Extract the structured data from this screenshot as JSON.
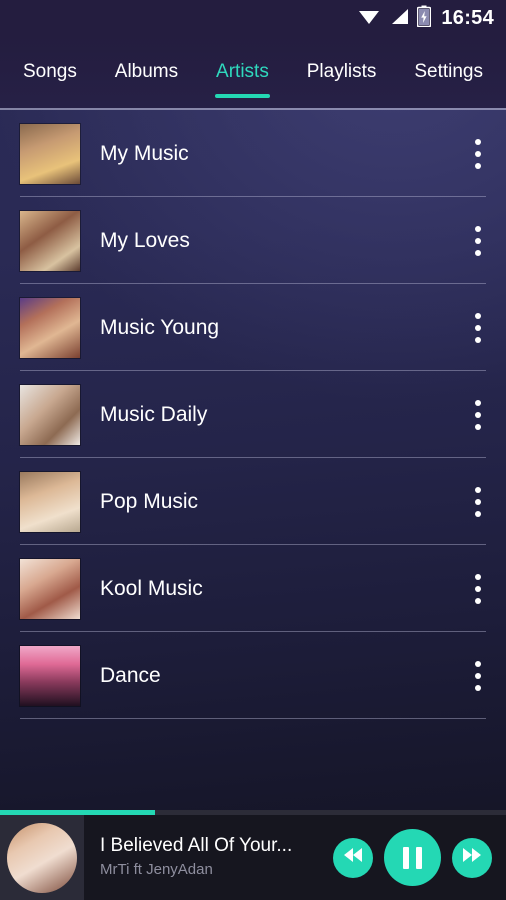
{
  "statusbar": {
    "time": "16:54",
    "icons": [
      "wifi-icon",
      "cellular-signal-icon",
      "battery-charging-icon"
    ]
  },
  "tabs": [
    {
      "label": "Songs",
      "active": false
    },
    {
      "label": "Albums",
      "active": false
    },
    {
      "label": "Artists",
      "active": true
    },
    {
      "label": "Playlists",
      "active": false
    },
    {
      "label": "Settings",
      "active": false
    }
  ],
  "artists": [
    {
      "name": "My Music",
      "thumb": "portrait-woman-yellow-dress"
    },
    {
      "name": "My Loves",
      "thumb": "portrait-couple-embrace"
    },
    {
      "name": "Music Young",
      "thumb": "portrait-woman-auburn-hair"
    },
    {
      "name": "Music Daily",
      "thumb": "portrait-woman-long-hair"
    },
    {
      "name": "Pop Music",
      "thumb": "portrait-woman-smiling"
    },
    {
      "name": "Kool Music",
      "thumb": "portrait-woman-closeup"
    },
    {
      "name": "Dance",
      "thumb": "concert-crowd-pink-lights"
    }
  ],
  "overflow_menu_icon": "three-dots-vertical-icon",
  "player": {
    "title": "I Believed All Of Your...",
    "artist": "MrTi ft JenyAdan",
    "art": "portrait-woman-headphones",
    "progress_percent": 30.6,
    "prev_icon": "skip-previous-icon",
    "play_state_icon": "pause-icon",
    "next_icon": "skip-next-icon"
  },
  "colors": {
    "accent": "#24d8b4",
    "accent_text": "#2fd8bd",
    "appbar": "#241d3f",
    "player_bg": "#16161f",
    "text_primary": "#ffffff",
    "text_secondary": "#8e8e9e"
  }
}
